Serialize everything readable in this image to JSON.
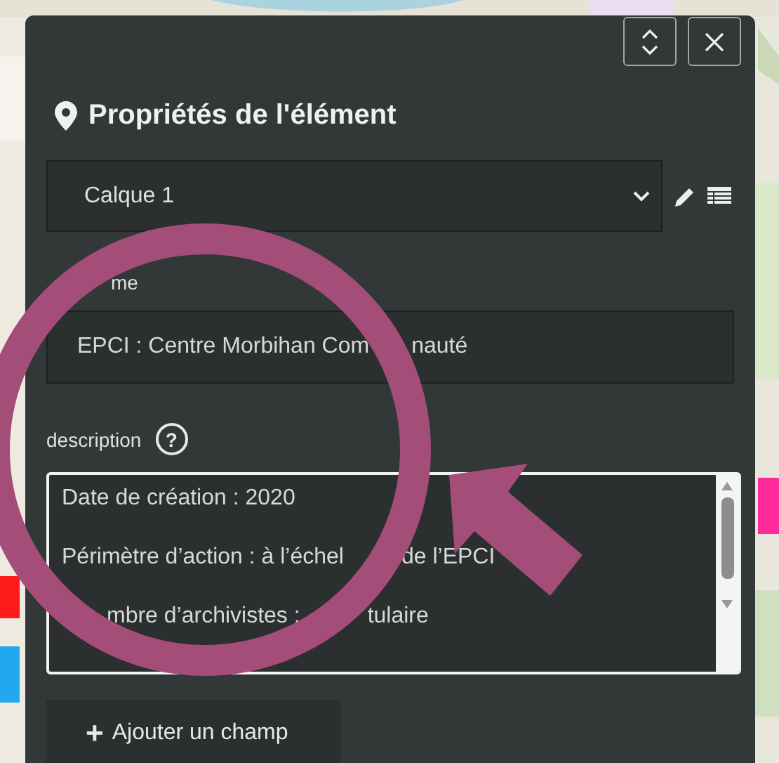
{
  "panel": {
    "title": "Propriétés de l'élément",
    "layer_select": {
      "value": "Calque 1"
    },
    "fields": [
      {
        "kind": "input",
        "label": [
          "me"
        ],
        "value": [
          "EPCI : Centre Morbihan Com",
          "nauté"
        ]
      },
      {
        "kind": "textarea",
        "label": [
          "description"
        ],
        "help": "?",
        "lines": [
          [
            "Date de création : 2020"
          ],
          [
            "Périmètre d’action : à l’échel",
            "de l’EPCI"
          ],
          [
            "mbre d’archivistes :",
            "tulaire"
          ]
        ]
      }
    ],
    "add_button": {
      "plus": "+",
      "label": "Ajouter un champ"
    }
  }
}
